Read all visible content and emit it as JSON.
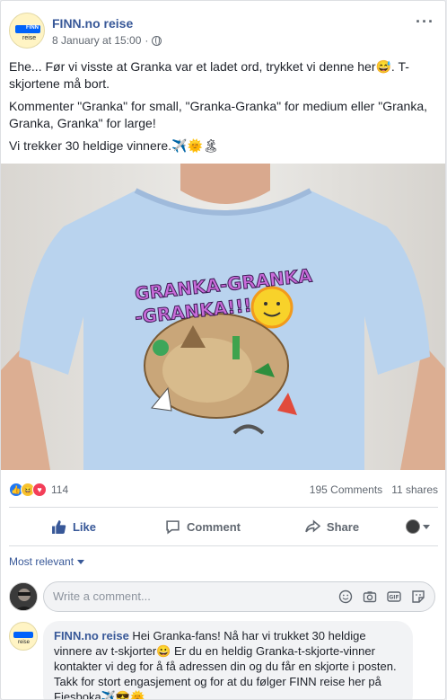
{
  "post": {
    "page_name": "FINN.no reise",
    "date": "8 January at 15:00",
    "dot": "·",
    "avatar": {
      "logo": "FINN",
      "sub": "reise"
    },
    "paragraphs": [
      "Ehe... Før vi visste at Granka var et ladet ord, trykket vi denne her😅. T-skjortene må bort.",
      "Kommenter \"Granka\" for small, \"Granka-Granka\" for medium eller \"Granka, Granka, Granka\" for large!",
      "Vi trekker 30 heldige vinnere.✈️🌞🏝"
    ],
    "image": {
      "shirt_color": "#b9d3ee",
      "print_text_1": "GRANKA-GRANKA",
      "print_text_2": "-GRANKA!!!"
    }
  },
  "stats": {
    "reactions": [
      "like",
      "haha",
      "love"
    ],
    "reaction_count": "114",
    "comments": "195 Comments",
    "shares": "11 shares"
  },
  "actions": {
    "like": "Like",
    "comment": "Comment",
    "share": "Share"
  },
  "filter": {
    "label": "Most relevant"
  },
  "composer": {
    "placeholder": "Write a comment..."
  },
  "comment": {
    "author": "FINN.no reise",
    "text": "Hei Granka-fans! Nå har vi trukket 30 heldige vinnere av t-skjorter😀 Er du en heldig Granka-t-skjorte-vinner kontakter vi deg for å få adressen din og du får en skjorte i posten. Takk for stort engasjement og for at du følger FINN reise her på Fjesboka✈️😎🌞"
  },
  "colors": {
    "brand": "#385898",
    "finn_blue": "#0063fb",
    "like_blue": "#2078f4"
  }
}
